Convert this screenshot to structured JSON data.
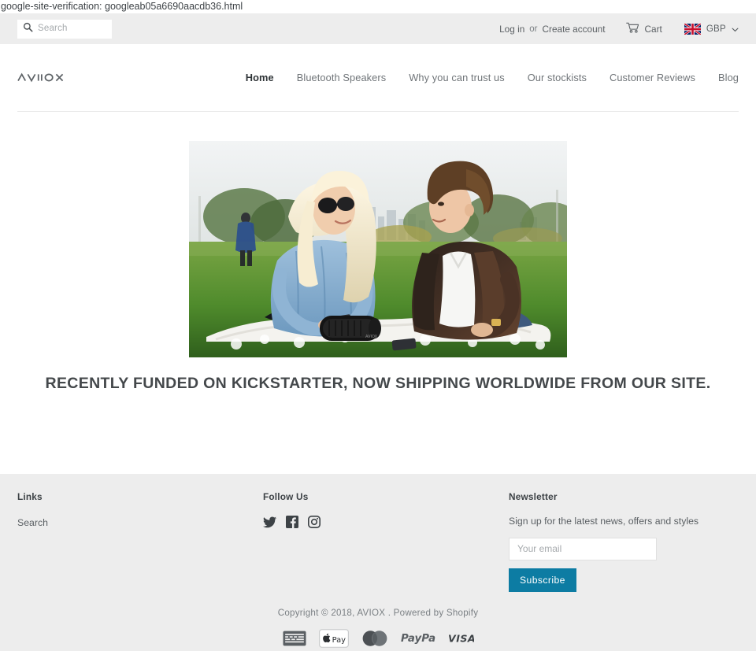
{
  "page": {
    "verification_text": "google-site-verification: googleab05a6690aacdb36.html",
    "brand": "AVIOX",
    "accent_color": "#0d7ca3",
    "topbar_bg": "#ededed",
    "footer_bg": "#ededed",
    "text_color": "#3d4246"
  },
  "topbar": {
    "search": {
      "icon": "search-icon",
      "placeholder": "Search",
      "value": ""
    },
    "login_label": "Log in",
    "separator_label": "or",
    "create_account_label": "Create account",
    "cart": {
      "icon": "shopping-cart-icon",
      "label": "Cart"
    },
    "currency": {
      "flag": "uk-flag-icon",
      "code": "GBP",
      "chevron": "chevron-down-icon"
    }
  },
  "header": {
    "logo_text": "AVIOX",
    "nav": [
      {
        "label": "Home",
        "active": true
      },
      {
        "label": "Bluetooth Speakers",
        "active": false
      },
      {
        "label": "Why you can trust us",
        "active": false
      },
      {
        "label": "Our stockists",
        "active": false
      },
      {
        "label": "Customer Reviews",
        "active": false
      },
      {
        "label": "Blog",
        "active": false
      }
    ]
  },
  "hero": {
    "alt": "Couple sitting on a white blanket in a park with a black AVIOX bluetooth speaker",
    "tagline": "RECENTLY FUNDED ON KICKSTARTER, NOW SHIPPING WORLDWIDE FROM OUR SITE."
  },
  "footer": {
    "links_column": {
      "title": "Links",
      "items": [
        {
          "label": "Search"
        }
      ]
    },
    "social_column": {
      "title": "Follow Us",
      "items": [
        {
          "name": "twitter-icon",
          "label": "Twitter"
        },
        {
          "name": "facebook-icon",
          "label": "Facebook"
        },
        {
          "name": "instagram-icon",
          "label": "Instagram"
        }
      ]
    },
    "newsletter": {
      "title": "Newsletter",
      "description": "Sign up for the latest news, offers and styles",
      "email_placeholder": "Your email",
      "email_value": "",
      "subscribe_label": "Subscribe"
    },
    "copyright": "Copyright © 2018, AVIOX . Powered by Shopify",
    "payment_methods": [
      {
        "name": "american-express-icon",
        "label": "American Express"
      },
      {
        "name": "apple-pay-icon",
        "label": "Apple Pay"
      },
      {
        "name": "mastercard-icon",
        "label": "Mastercard"
      },
      {
        "name": "paypal-icon",
        "label": "PayPal"
      },
      {
        "name": "visa-icon",
        "label": "VISA"
      }
    ]
  }
}
